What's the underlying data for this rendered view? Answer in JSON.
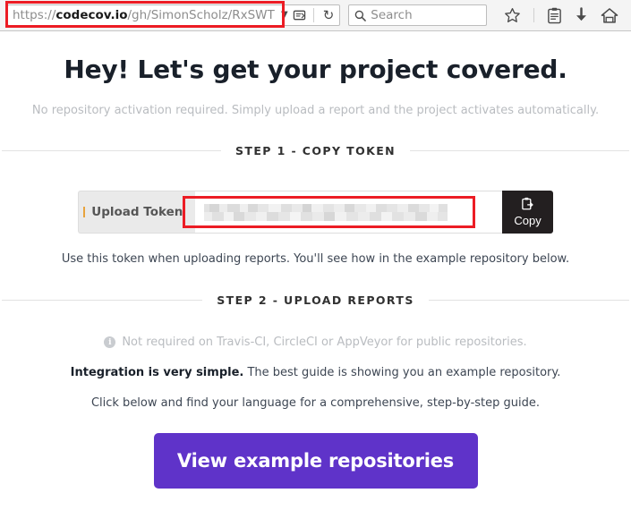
{
  "browser": {
    "url": {
      "scheme": "https://",
      "host": "codecov.io",
      "path": "/gh/SimonScholz/RxSWT",
      "full": "https://codecov.io/gh/SimonScholz/RxSWT"
    },
    "dropdown_icon": "chevron-down-icon",
    "page_actions_icon": "page-actions-icon",
    "reload_icon": "reload-icon",
    "search": {
      "placeholder": "Search",
      "value": "",
      "icon": "search-icon"
    },
    "toolbar_icons": [
      {
        "name": "bookmark-star-icon",
        "glyph": "☆"
      },
      {
        "name": "reading-list-icon",
        "glyph": "🗉"
      },
      {
        "name": "downloads-icon",
        "glyph": "⬇"
      },
      {
        "name": "home-icon",
        "glyph": "🏠"
      }
    ]
  },
  "hero": {
    "title": "Hey! Let's get your project covered.",
    "subtitle": "No repository activation required. Simply upload a report and the project activates automatically."
  },
  "step1": {
    "header": "STEP 1 - COPY TOKEN",
    "token_label": "Upload Token",
    "token_value": "",
    "token_redacted": true,
    "copy_button": {
      "label": "Copy",
      "icon": "clipboard-copy-icon"
    },
    "helper_text": "Use this token when uploading reports. You'll see how in the example repository below."
  },
  "step2": {
    "header": "STEP 2 - UPLOAD REPORTS",
    "note": {
      "icon": "info-icon",
      "text": "Not required on Travis-CI, CircleCI or AppVeyor for public repositories."
    },
    "line1_bold": "Integration is very simple.",
    "line1_rest": " The best guide is showing you an example repository.",
    "line2": "Click below and find your language for a comprehensive, step-by-step guide.",
    "cta_label": "View example repositories"
  },
  "colors": {
    "accent_purple": "#5f33c9",
    "highlight_red": "#ec1c24",
    "copy_button_bg": "#231f20",
    "muted_text": "#b9bcc0",
    "body_text": "#3d4653"
  }
}
